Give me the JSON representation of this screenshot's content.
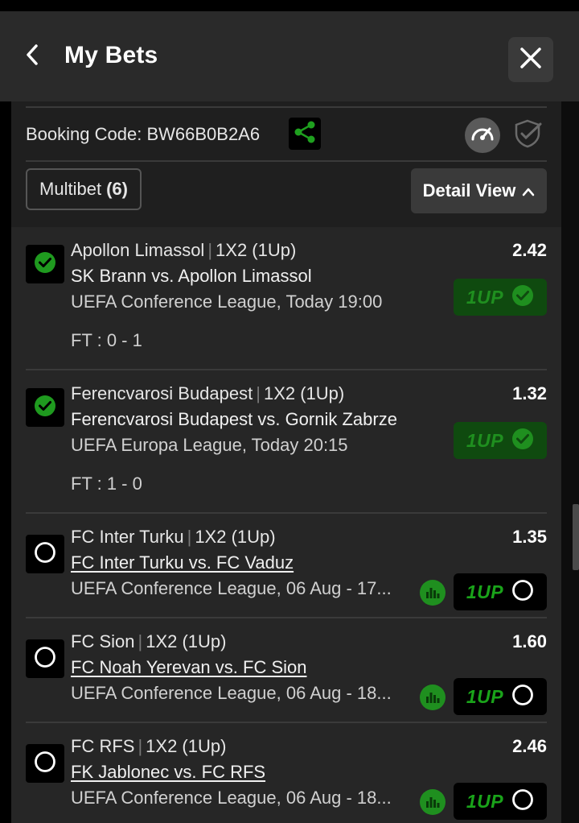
{
  "header": {
    "title": "My Bets",
    "back_icon": "chevron-left-icon",
    "close_icon": "close-icon"
  },
  "booking": {
    "label": "Booking Code:",
    "code": "BW66B0B2A6"
  },
  "multibet": {
    "label": "Multibet",
    "count": "(6)"
  },
  "detail_view": {
    "label": "Detail View"
  },
  "colors": {
    "accent_green": "#1f8f1f",
    "won_bg": "#0f4a0f",
    "panel_bg": "#1f1f1f"
  },
  "bets": [
    {
      "selection": "Apollon Limassol",
      "market": "1X2 (1Up)",
      "match": "SK Brann vs. Apollon Limassol",
      "competition": "UEFA Conference League, Today 19:00",
      "odds": "2.42",
      "result": "FT : 0 - 1",
      "status": "won",
      "oneup_label": "1UP"
    },
    {
      "selection": "Ferencvarosi Budapest",
      "market": "1X2 (1Up)",
      "match": "Ferencvarosi Budapest vs. Gornik Zabrze",
      "competition": "UEFA Europa League, Today 20:15",
      "odds": "1.32",
      "result": "FT : 1 - 0",
      "status": "won",
      "oneup_label": "1UP"
    },
    {
      "selection": "FC Inter Turku",
      "market": "1X2 (1Up)",
      "match": "FC Inter Turku vs. FC Vaduz",
      "competition": "UEFA Conference League, 06 Aug - 17...",
      "odds": "1.35",
      "status": "open",
      "oneup_label": "1UP"
    },
    {
      "selection": "FC Sion",
      "market": "1X2 (1Up)",
      "match": "FC Noah Yerevan vs. FC Sion",
      "competition": "UEFA Conference League, 06 Aug - 18...",
      "odds": "1.60",
      "status": "open",
      "oneup_label": "1UP"
    },
    {
      "selection": "FC RFS",
      "market": "1X2 (1Up)",
      "match": "FK Jablonec vs. FC RFS",
      "competition": "UEFA Conference League, 06 Aug - 18...",
      "odds": "2.46",
      "status": "open",
      "oneup_label": "1UP"
    }
  ]
}
